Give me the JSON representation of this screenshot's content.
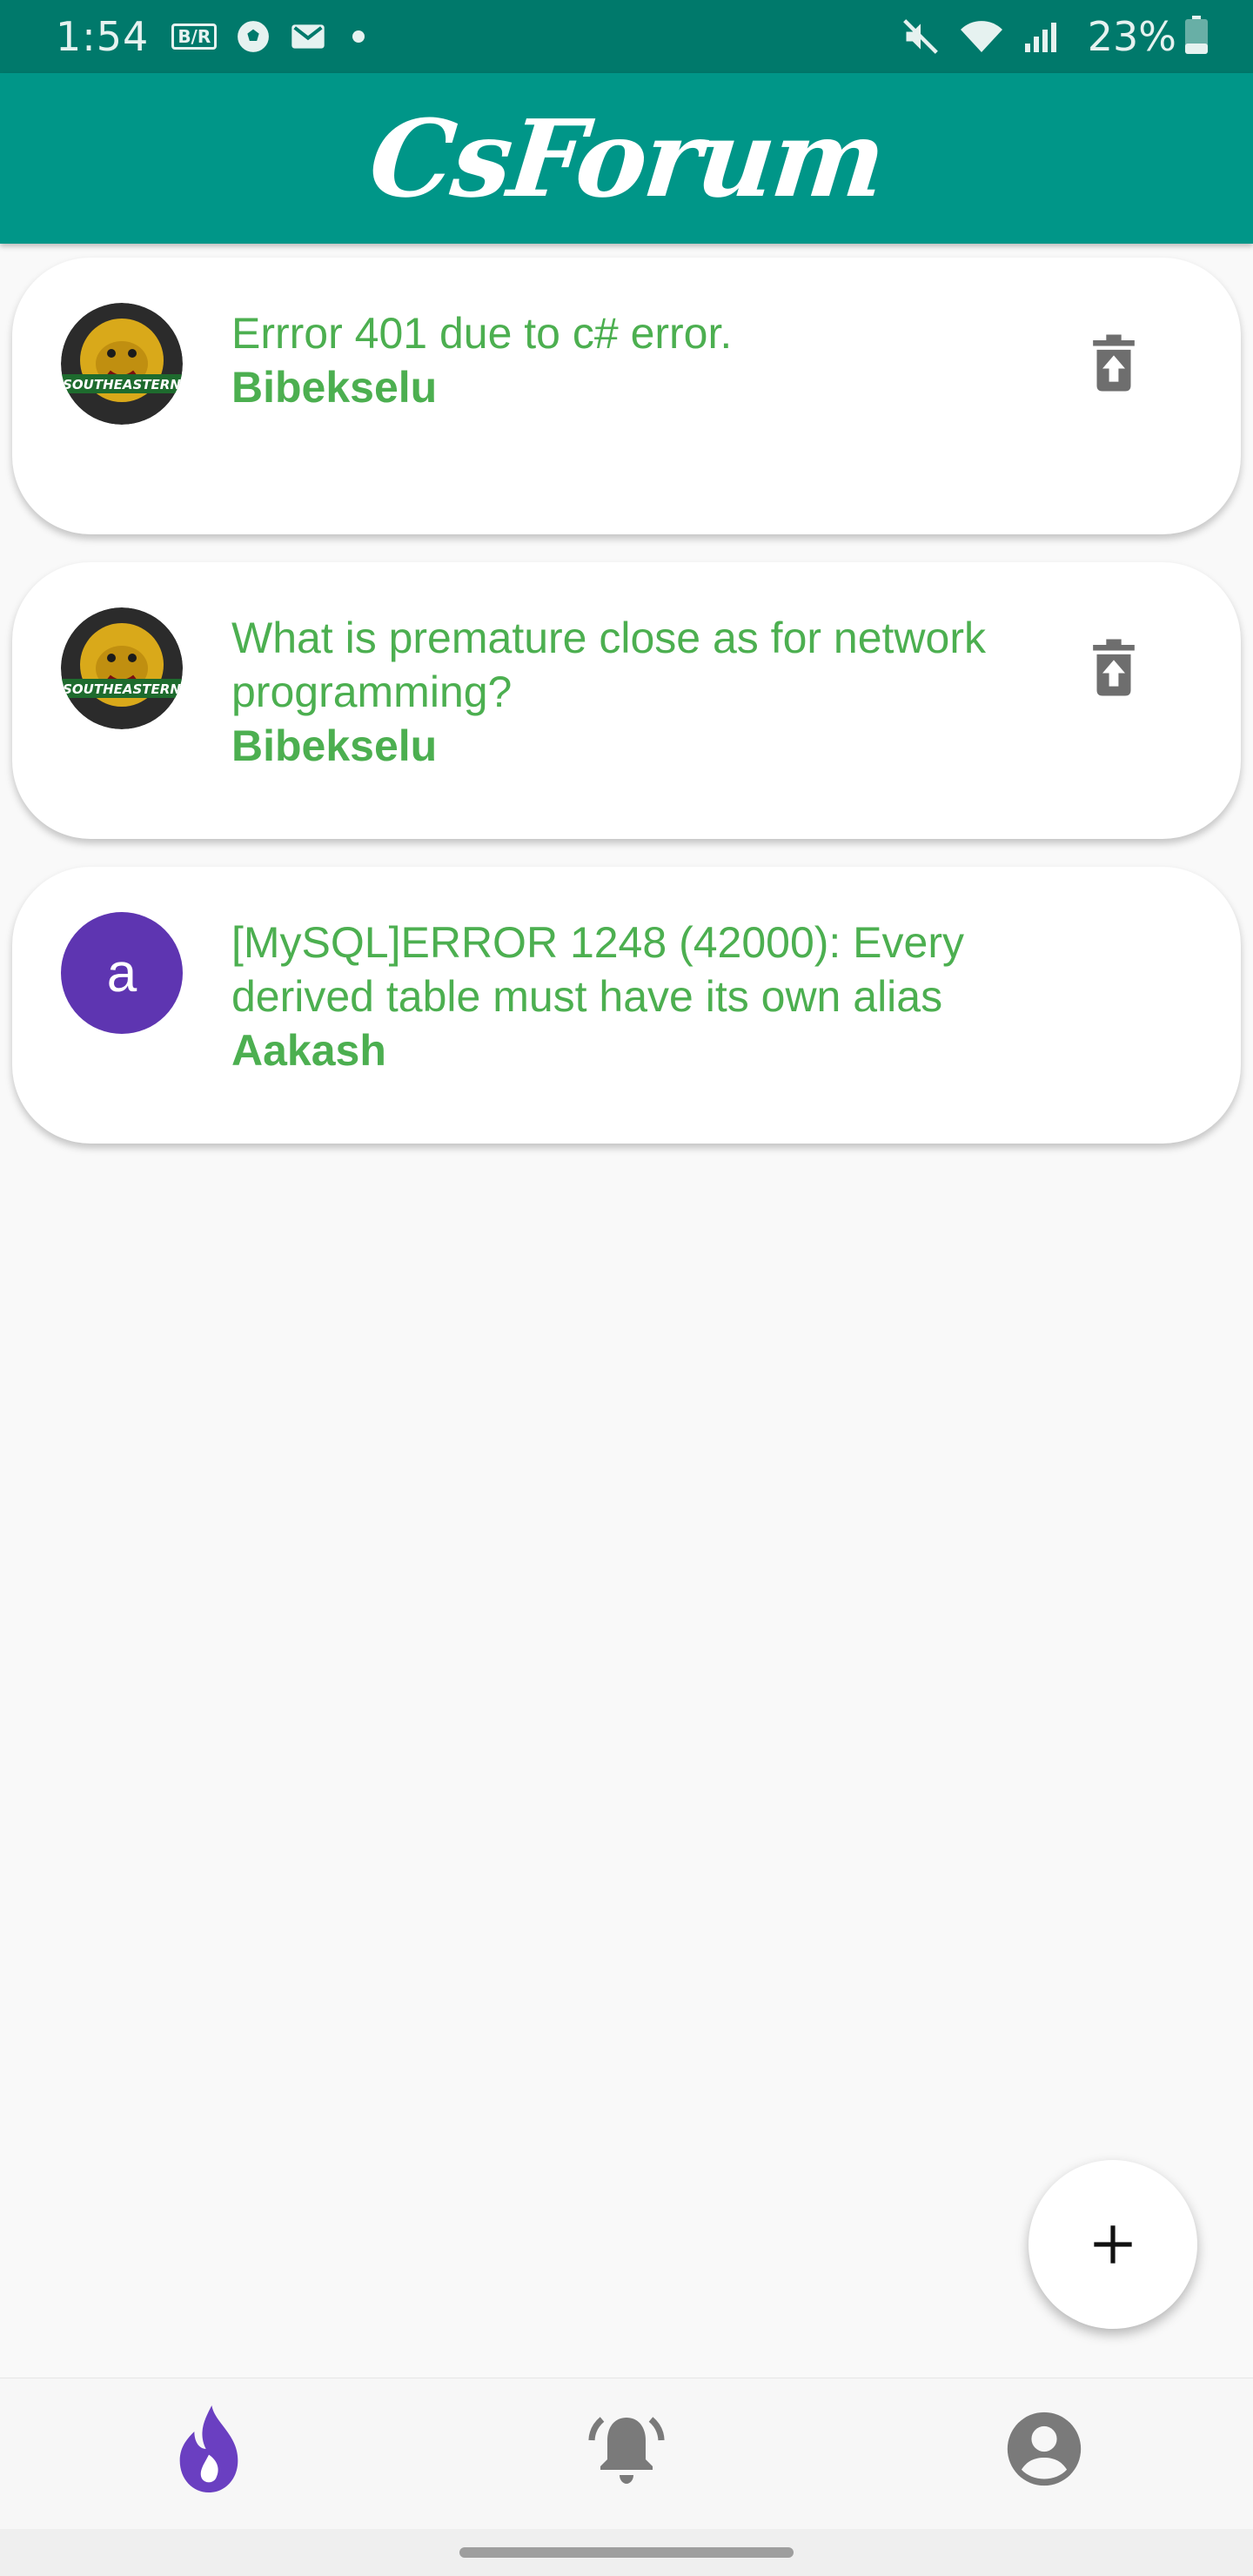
{
  "status_bar": {
    "time": "1:54",
    "notification_icons": [
      "br-icon",
      "soccer-ball-icon",
      "mail-icon",
      "dot-icon"
    ],
    "system_icons": [
      "mute-icon",
      "wifi-icon",
      "signal-icon",
      "battery-icon"
    ],
    "notif_br_label": "B/R",
    "battery_percent": "23%"
  },
  "app_bar": {
    "title": "CsForum",
    "background_color": "#009688"
  },
  "posts": [
    {
      "title": "Errror 401 due to c# error.",
      "author": "Bibekselu",
      "avatar": "southeastern-lion-logo",
      "deletable": true
    },
    {
      "title": "What is premature close as for network programming?",
      "author": "Bibekselu",
      "avatar": "southeastern-lion-logo",
      "deletable": true
    },
    {
      "title": "[MySQL]ERROR 1248 (42000): Every derived table must have its own alias",
      "author": "Aakash",
      "avatar_letter": "a",
      "avatar_color": "#5e35b1",
      "deletable": false
    }
  ],
  "fab": {
    "icon": "plus-icon"
  },
  "bottom_nav": {
    "items": [
      {
        "icon": "flame-icon",
        "active": true
      },
      {
        "icon": "bell-ringing-icon",
        "active": false
      },
      {
        "icon": "account-circle-icon",
        "active": false
      }
    ],
    "active_color": "#6a3fc1",
    "inactive_color": "#7a7a7a"
  },
  "logo_text": "SOUTHEASTERN"
}
